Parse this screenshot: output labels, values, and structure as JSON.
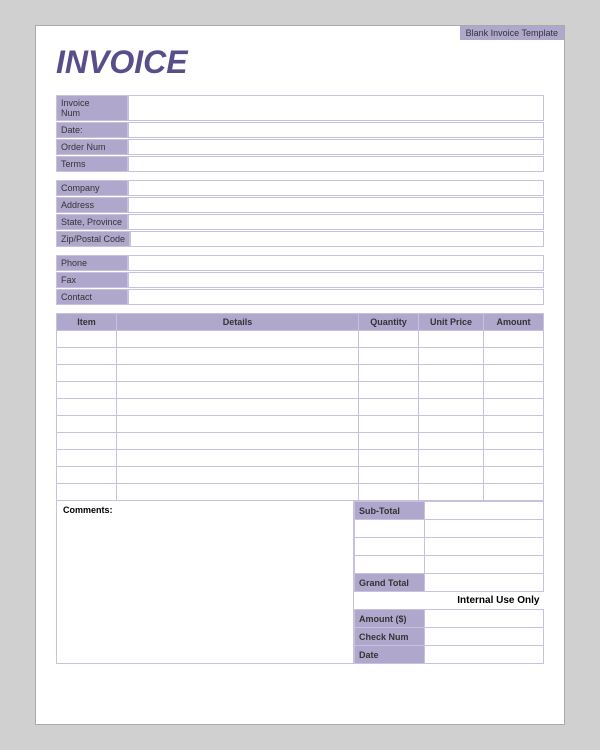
{
  "template": {
    "label": "Blank Invoice Template"
  },
  "header": {
    "title": "INVOICE"
  },
  "invoice_info": [
    {
      "label": "Invoice Num",
      "value": ""
    },
    {
      "label": "Date:",
      "value": ""
    },
    {
      "label": "Order Num",
      "value": ""
    },
    {
      "label": "Terms",
      "value": ""
    }
  ],
  "company_info": [
    {
      "label": "Company",
      "value": ""
    },
    {
      "label": "Address",
      "value": ""
    },
    {
      "label": "State, Province",
      "value": ""
    },
    {
      "label": "Zip/Postal Code",
      "value": ""
    }
  ],
  "contact_info": [
    {
      "label": "Phone",
      "value": ""
    },
    {
      "label": "Fax",
      "value": ""
    },
    {
      "label": "Contact",
      "value": ""
    }
  ],
  "table": {
    "headers": [
      "Item",
      "Details",
      "Quantity",
      "Unit Price",
      "Amount"
    ],
    "rows": 10
  },
  "comments_label": "Comments:",
  "totals": {
    "subtotal_label": "Sub-Total",
    "subtotal_value": "",
    "row2_label": "",
    "row2_value": "",
    "row3_label": "",
    "row3_value": "",
    "grand_total_label": "Grand Total",
    "grand_total_value": ""
  },
  "internal_use": {
    "label": "Internal Use Only",
    "amount_label": "Amount ($)",
    "check_label": "Check Num",
    "date_label": "Date"
  }
}
